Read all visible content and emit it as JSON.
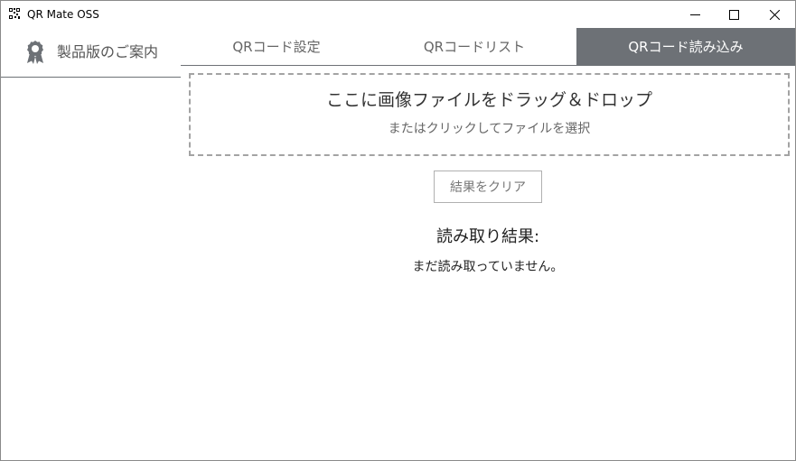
{
  "window": {
    "title": "QR Mate OSS"
  },
  "sidebar": {
    "product_guide_label": "製品版のご案内"
  },
  "tabs": [
    {
      "label": "QRコード設定",
      "active": false
    },
    {
      "label": "QRコードリスト",
      "active": false
    },
    {
      "label": "QRコード読み込み",
      "active": true
    }
  ],
  "dropzone": {
    "title": "ここに画像ファイルをドラッグ＆ドロップ",
    "subtitle": "またはクリックしてファイルを選択"
  },
  "actions": {
    "clear_label": "結果をクリア"
  },
  "result": {
    "heading": "読み取り結果:",
    "text": "まだ読み取っていません。"
  },
  "icons": {
    "app": "qr-code-icon",
    "product_guide": "award-ribbon-icon",
    "minimize": "minimize-icon",
    "maximize": "maximize-icon",
    "close": "close-icon"
  },
  "colors": {
    "active_tab": "#6d7176",
    "active_tab_text": "#ffffff",
    "dropzone_border": "#a3a3a3"
  }
}
